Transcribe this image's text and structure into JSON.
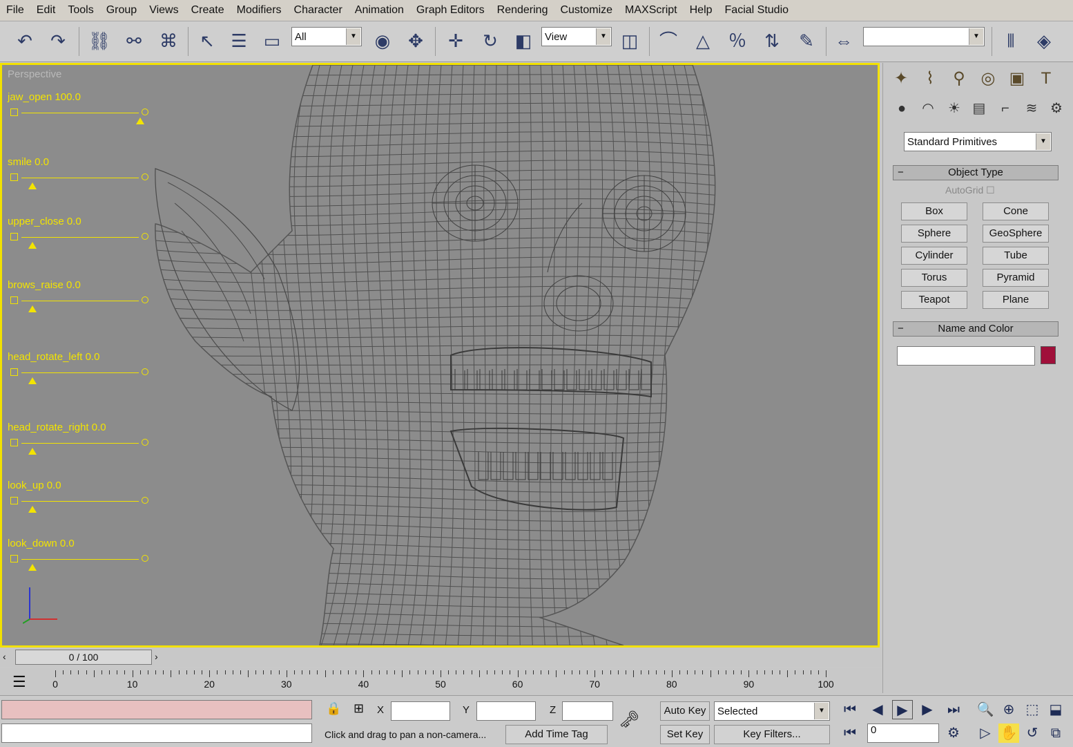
{
  "menu": [
    "File",
    "Edit",
    "Tools",
    "Group",
    "Views",
    "Create",
    "Modifiers",
    "Character",
    "Animation",
    "Graph Editors",
    "Rendering",
    "Customize",
    "MAXScript",
    "Help",
    "Facial Studio"
  ],
  "toolbar": {
    "selection_filter": "All",
    "reference_coord": "View",
    "named_selection": ""
  },
  "viewport": {
    "label": "Perspective",
    "sliders": [
      {
        "label": "jaw_open 100.0",
        "value": 100.0
      },
      {
        "label": "smile 0.0",
        "value": 0.0
      },
      {
        "label": "upper_close 0.0",
        "value": 0.0
      },
      {
        "label": "brows_raise 0.0",
        "value": 0.0
      },
      {
        "label": "head_rotate_left 0.0",
        "value": 0.0
      },
      {
        "label": "head_rotate_right 0.0",
        "value": 0.0
      },
      {
        "label": "look_up 0.0",
        "value": 0.0
      },
      {
        "label": "look_down 0.0",
        "value": 0.0
      }
    ]
  },
  "command_panel": {
    "category": "Standard Primitives",
    "object_type_title": "Object Type",
    "autogrid": "AutoGrid",
    "primitives": [
      "Box",
      "Cone",
      "Sphere",
      "GeoSphere",
      "Cylinder",
      "Tube",
      "Torus",
      "Pyramid",
      "Teapot",
      "Plane"
    ],
    "name_color_title": "Name and Color",
    "object_name": "",
    "object_color": "#a0103a"
  },
  "timeline": {
    "frame_display": "0 / 100",
    "ticks": [
      "0",
      "10",
      "20",
      "30",
      "40",
      "50",
      "60",
      "70",
      "80",
      "90",
      "100"
    ]
  },
  "status": {
    "x_label": "X",
    "y_label": "Y",
    "z_label": "Z",
    "x_value": "",
    "y_value": "",
    "z_value": "",
    "prompt": "Click and drag to pan a non-camera...",
    "add_time_tag": "Add Time Tag",
    "auto_key": "Auto Key",
    "set_key": "Set Key",
    "key_mode": "Selected",
    "key_filters": "Key Filters...",
    "current_frame": "0"
  },
  "colors": {
    "viewport_bg": "#8c8c8c",
    "viewport_border": "#f2e100",
    "slider_yellow": "#f3e400",
    "wire_grey": "#4a4a4a",
    "prompt_pink": "#e8c0c0"
  }
}
